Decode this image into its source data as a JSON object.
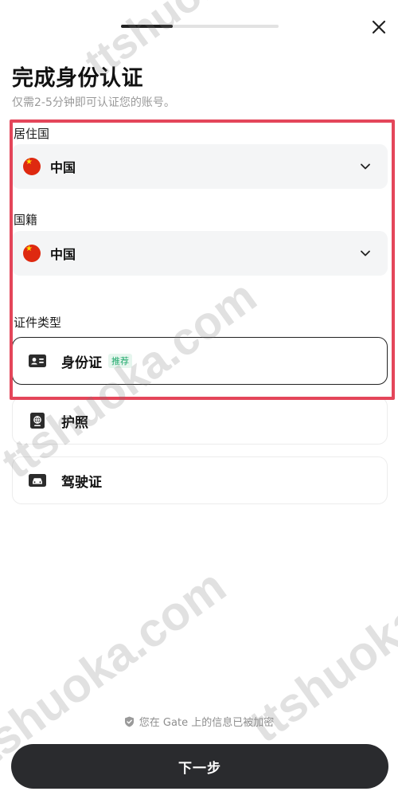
{
  "progress": {
    "value": 0.33
  },
  "header": {
    "title": "完成身份认证",
    "subtitle": "仅需2-5分钟即可认证您的账号。"
  },
  "residence": {
    "label": "居住国",
    "value": "中国",
    "icon": "flag-china-icon"
  },
  "nationality": {
    "label": "国籍",
    "value": "中国",
    "icon": "flag-china-icon"
  },
  "document": {
    "label": "证件类型",
    "options": [
      {
        "label": "身份证",
        "badge": "推荐",
        "icon": "id-card-icon",
        "selected": true
      },
      {
        "label": "护照",
        "icon": "passport-icon",
        "selected": false
      },
      {
        "label": "驾驶证",
        "icon": "driver-license-icon",
        "selected": false
      }
    ]
  },
  "security_note": "您在 Gate 上的信息已被加密",
  "next_button": "下一步",
  "watermark": "ttshuoka.com",
  "colors": {
    "highlight_frame": "#e4465a",
    "primary_button": "#2a2b2e",
    "badge_text": "#1fa86b",
    "badge_bg": "#e6f6ee"
  }
}
